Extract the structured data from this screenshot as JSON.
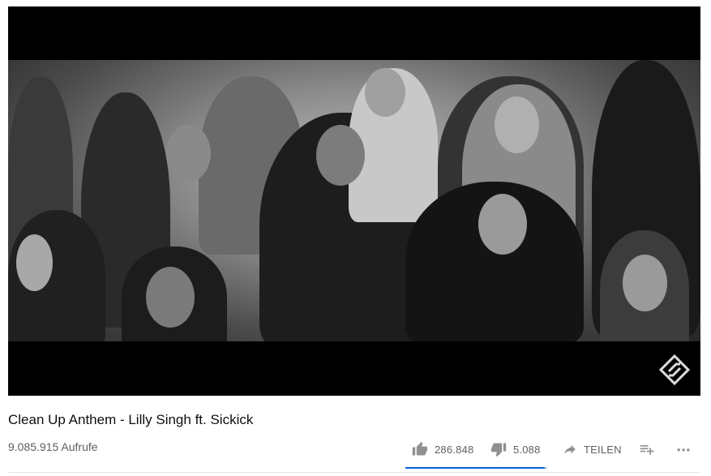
{
  "video": {
    "title": "Clean Up Anthem - Lilly Singh ft. Sickick",
    "views": "9.085.915 Aufrufe"
  },
  "actions": {
    "likes": "286.848",
    "dislikes": "5.088",
    "share_label": "TEILEN"
  },
  "sentiment": {
    "like_ratio": 0.983
  },
  "icons": {
    "like": "thumb-up-icon",
    "dislike": "thumb-down-icon",
    "share": "share-arrow-icon",
    "save": "playlist-add-icon",
    "more": "more-horizontal-icon",
    "watermark": "channel-watermark-icon"
  },
  "colors": {
    "sentiment_fill": "#065fd4",
    "sentiment_track": "#cccccc",
    "secondary_text": "#606060",
    "title_text": "#0f0f0f"
  }
}
